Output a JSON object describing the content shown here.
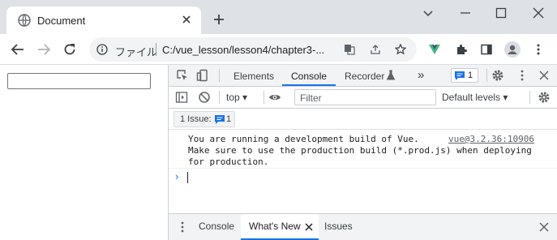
{
  "browser": {
    "tab_title": "Document",
    "site_label": "ファイル",
    "url": "C:/vue_lesson/lesson4/chapter3-..."
  },
  "page": {
    "input_value": ""
  },
  "devtools": {
    "tabs": [
      "Elements",
      "Console",
      "Recorder"
    ],
    "active_tab": "Console",
    "more_tabs_glyph": "»",
    "issues_badge_count": "1",
    "context": "top",
    "filter_placeholder": "Filter",
    "levels_label": "Default levels",
    "issue_label": "1 Issue:",
    "issue_count": "1",
    "log": {
      "message": "You are running a development build of Vue.\nMake sure to use the production build (*.prod.js) when deploying\nfor production.",
      "source": "vue@3.2.36:10906"
    },
    "prompt_glyph": "›",
    "drawer_tabs": [
      "Console",
      "What's New",
      "Issues"
    ],
    "accent_color": "#1a73e8"
  }
}
